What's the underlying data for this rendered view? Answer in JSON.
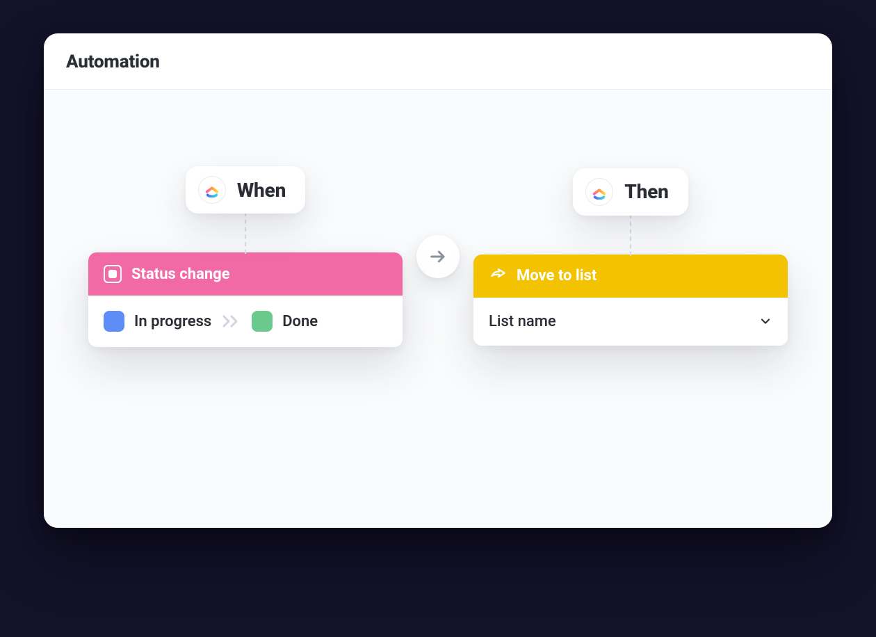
{
  "header": {
    "title": "Automation"
  },
  "when": {
    "pill_label": "When",
    "card_title": "Status change",
    "from_status": {
      "label": "In progress",
      "color": "#5f8df7"
    },
    "to_status": {
      "label": "Done",
      "color": "#6ac98d"
    }
  },
  "then": {
    "pill_label": "Then",
    "card_title": "Move to list",
    "select_placeholder": "List name"
  },
  "colors": {
    "trigger_header": "#f16aa5",
    "action_header": "#f3c200"
  }
}
